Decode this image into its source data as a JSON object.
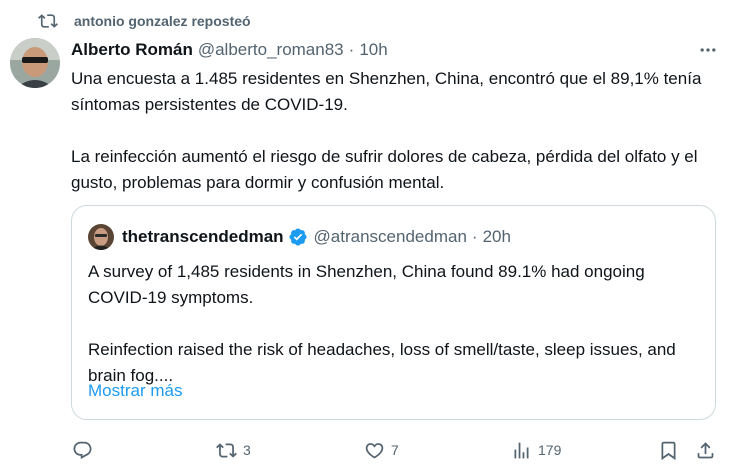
{
  "repost": {
    "text": "antonio gonzalez reposteó",
    "icon": "repost-icon"
  },
  "tweet": {
    "name": "Alberto Román",
    "handle": "@alberto_roman83",
    "separator": "·",
    "time": "10h",
    "paragraphs": [
      "Una encuesta a 1.485 residentes en Shenzhen, China, encontró que el 89,1% tenía síntomas persistentes de COVID-19.",
      "La reinfección aumentó el riesgo de sufrir dolores de cabeza, pérdida del olfato y el gusto, problemas para dormir y confusión mental."
    ]
  },
  "quote": {
    "name": "thetranscendedman",
    "handle": "@atranscendedman",
    "separator": "·",
    "time": "20h",
    "paragraphs": [
      "A survey of 1,485 residents in Shenzhen, China found 89.1% had ongoing COVID-19 symptoms.",
      "Reinfection raised the risk of headaches, loss of smell/taste, sleep issues, and brain fog...."
    ],
    "show_more": "Mostrar más"
  },
  "actions": {
    "reply": "",
    "reposts": "3",
    "likes": "7",
    "views": "179"
  },
  "colors": {
    "text": "#0f1419",
    "secondary": "#536471",
    "link": "#1d9bf0",
    "border": "#cfd9de"
  }
}
